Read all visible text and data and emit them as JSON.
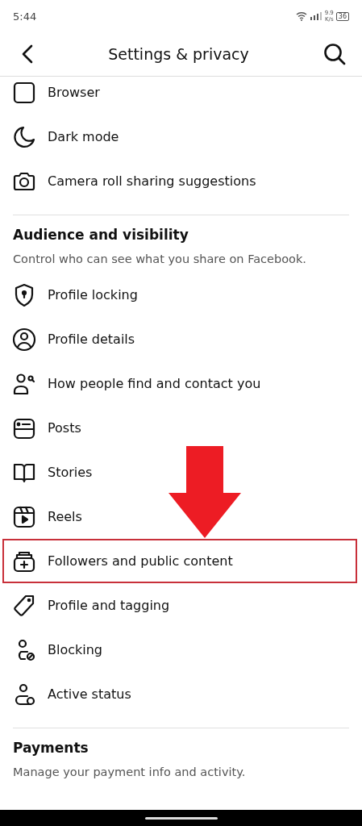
{
  "status_bar": {
    "time": "5:44",
    "speed_value": "9.9",
    "speed_unit": "K/s",
    "battery": "36"
  },
  "header": {
    "title": "Settings & privacy"
  },
  "sections": [
    {
      "items": [
        {
          "label": "Browser",
          "highlighted": false
        },
        {
          "label": "Dark mode",
          "highlighted": false
        },
        {
          "label": "Camera roll sharing suggestions",
          "highlighted": false
        }
      ]
    },
    {
      "heading": "Audience and visibility",
      "description": "Control who can see what you share on Facebook.",
      "items": [
        {
          "label": "Profile locking",
          "highlighted": false
        },
        {
          "label": "Profile details",
          "highlighted": false
        },
        {
          "label": "How people find and contact you",
          "highlighted": false
        },
        {
          "label": "Posts",
          "highlighted": false
        },
        {
          "label": "Stories",
          "highlighted": false
        },
        {
          "label": "Reels",
          "highlighted": false
        },
        {
          "label": "Followers and public content",
          "highlighted": true
        },
        {
          "label": "Profile and tagging",
          "highlighted": false
        },
        {
          "label": "Blocking",
          "highlighted": false
        },
        {
          "label": "Active status",
          "highlighted": false
        }
      ]
    },
    {
      "heading": "Payments",
      "description": "Manage your payment info and activity."
    }
  ]
}
